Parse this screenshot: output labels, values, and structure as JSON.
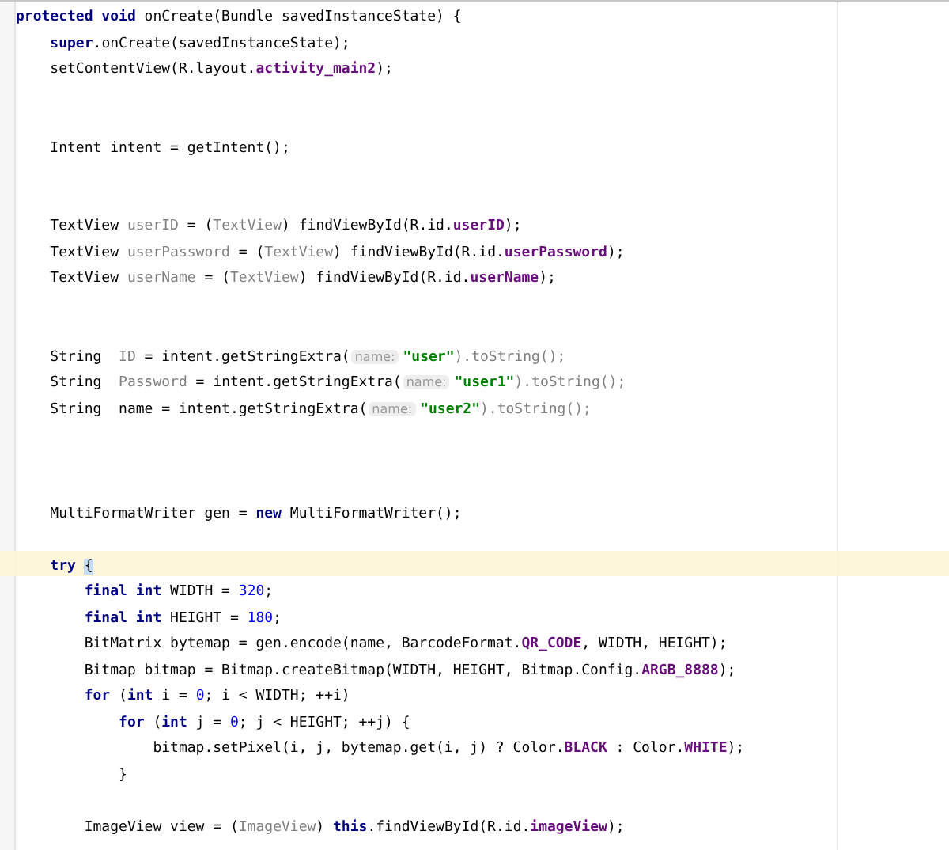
{
  "editor": {
    "lines": [
      {
        "current": false,
        "tokens": [
          {
            "kind": "k",
            "text": "protected void "
          },
          {
            "kind": "p",
            "text": "onCreate(Bundle savedInstanceState) {"
          }
        ]
      },
      {
        "current": false,
        "tokens": [
          {
            "kind": "k",
            "text": "    super"
          },
          {
            "kind": "p",
            "text": ".onCreate(savedInstanceState);"
          }
        ]
      },
      {
        "current": false,
        "tokens": [
          {
            "kind": "p",
            "text": "    setContentView(R.layout."
          },
          {
            "kind": "f",
            "text": "activity_main2"
          },
          {
            "kind": "p",
            "text": ");"
          }
        ]
      },
      {
        "current": false
      },
      {
        "current": false
      },
      {
        "current": false,
        "tokens": [
          {
            "kind": "p",
            "text": "    Intent intent = getIntent();"
          }
        ]
      },
      {
        "current": false
      },
      {
        "current": false
      },
      {
        "current": false,
        "tokens": [
          {
            "kind": "p",
            "text": "    TextView "
          },
          {
            "kind": "g",
            "text": "userID"
          },
          {
            "kind": "p",
            "text": " = ("
          },
          {
            "kind": "g",
            "text": "TextView"
          },
          {
            "kind": "p",
            "text": ") findViewById(R.id."
          },
          {
            "kind": "f",
            "text": "userID"
          },
          {
            "kind": "p",
            "text": ");"
          }
        ]
      },
      {
        "current": false,
        "tokens": [
          {
            "kind": "p",
            "text": "    TextView "
          },
          {
            "kind": "g",
            "text": "userPassword"
          },
          {
            "kind": "p",
            "text": " = ("
          },
          {
            "kind": "g",
            "text": "TextView"
          },
          {
            "kind": "p",
            "text": ") findViewById(R.id."
          },
          {
            "kind": "f",
            "text": "userPassword"
          },
          {
            "kind": "p",
            "text": ");"
          }
        ]
      },
      {
        "current": false,
        "tokens": [
          {
            "kind": "p",
            "text": "    TextView "
          },
          {
            "kind": "g",
            "text": "userName"
          },
          {
            "kind": "p",
            "text": " = ("
          },
          {
            "kind": "g",
            "text": "TextView"
          },
          {
            "kind": "p",
            "text": ") findViewById(R.id."
          },
          {
            "kind": "f",
            "text": "userName"
          },
          {
            "kind": "p",
            "text": ");"
          }
        ]
      },
      {
        "current": false
      },
      {
        "current": false
      },
      {
        "current": false,
        "tokens": [
          {
            "kind": "p",
            "text": "    String  "
          },
          {
            "kind": "g",
            "text": "ID"
          },
          {
            "kind": "p",
            "text": " = intent.getStringExtra("
          },
          {
            "kind": "h",
            "text": "name:"
          },
          {
            "kind": "s",
            "text": "\"user\""
          },
          {
            "kind": "g",
            "text": ").toString();"
          }
        ]
      },
      {
        "current": false,
        "tokens": [
          {
            "kind": "p",
            "text": "    String  "
          },
          {
            "kind": "g",
            "text": "Password"
          },
          {
            "kind": "p",
            "text": " = intent.getStringExtra("
          },
          {
            "kind": "h",
            "text": "name:"
          },
          {
            "kind": "s",
            "text": "\"user1\""
          },
          {
            "kind": "g",
            "text": ").toString();"
          }
        ]
      },
      {
        "current": false,
        "tokens": [
          {
            "kind": "p",
            "text": "    String  name = intent.getStringExtra("
          },
          {
            "kind": "h",
            "text": "name:"
          },
          {
            "kind": "s",
            "text": "\"user2\""
          },
          {
            "kind": "g",
            "text": ").toString();"
          }
        ]
      },
      {
        "current": false
      },
      {
        "current": false
      },
      {
        "current": false
      },
      {
        "current": false,
        "tokens": [
          {
            "kind": "p",
            "text": "    MultiFormatWriter gen = "
          },
          {
            "kind": "k",
            "text": "new"
          },
          {
            "kind": "p",
            "text": " MultiFormatWriter();"
          }
        ]
      },
      {
        "current": false
      },
      {
        "current": true,
        "tokens": [
          {
            "kind": "k",
            "text": "    try"
          },
          {
            "kind": "m",
            "text": " {"
          }
        ]
      },
      {
        "current": false,
        "tokens": [
          {
            "kind": "k",
            "text": "        final int"
          },
          {
            "kind": "p",
            "text": " WIDTH = "
          },
          {
            "kind": "n",
            "text": "320"
          },
          {
            "kind": "p",
            "text": ";"
          }
        ]
      },
      {
        "current": false,
        "tokens": [
          {
            "kind": "k",
            "text": "        final int"
          },
          {
            "kind": "p",
            "text": " HEIGHT = "
          },
          {
            "kind": "n",
            "text": "180"
          },
          {
            "kind": "p",
            "text": ";"
          }
        ]
      },
      {
        "current": false,
        "tokens": [
          {
            "kind": "p",
            "text": "        BitMatrix bytemap = gen.encode(name, BarcodeFormat."
          },
          {
            "kind": "f",
            "text": "QR_CODE"
          },
          {
            "kind": "p",
            "text": ", WIDTH, HEIGHT);"
          }
        ]
      },
      {
        "current": false,
        "tokens": [
          {
            "kind": "p",
            "text": "        Bitmap bitmap = Bitmap.createBitmap(WIDTH, HEIGHT, Bitmap.Config."
          },
          {
            "kind": "f",
            "text": "ARGB_8888"
          },
          {
            "kind": "p",
            "text": ");"
          }
        ]
      },
      {
        "current": false,
        "tokens": [
          {
            "kind": "k",
            "text": "        for"
          },
          {
            "kind": "p",
            "text": " ("
          },
          {
            "kind": "k",
            "text": "int"
          },
          {
            "kind": "p",
            "text": " i = "
          },
          {
            "kind": "n",
            "text": "0"
          },
          {
            "kind": "p",
            "text": "; i < WIDTH; ++i)"
          }
        ]
      },
      {
        "current": false,
        "tokens": [
          {
            "kind": "k",
            "text": "            for"
          },
          {
            "kind": "p",
            "text": " ("
          },
          {
            "kind": "k",
            "text": "int"
          },
          {
            "kind": "p",
            "text": " j = "
          },
          {
            "kind": "n",
            "text": "0"
          },
          {
            "kind": "p",
            "text": "; j < HEIGHT; ++j) {"
          }
        ]
      },
      {
        "current": false,
        "tokens": [
          {
            "kind": "p",
            "text": "                bitmap.setPixel(i, j, bytemap.get(i, j) ? Color."
          },
          {
            "kind": "f",
            "text": "BLACK"
          },
          {
            "kind": "p",
            "text": " : Color."
          },
          {
            "kind": "f",
            "text": "WHITE"
          },
          {
            "kind": "p",
            "text": ");"
          }
        ]
      },
      {
        "current": false,
        "tokens": [
          {
            "kind": "p",
            "text": "            }"
          }
        ]
      },
      {
        "current": false
      },
      {
        "current": false,
        "tokens": [
          {
            "kind": "p",
            "text": "        ImageView view = ("
          },
          {
            "kind": "g",
            "text": "ImageView"
          },
          {
            "kind": "p",
            "text": ") "
          },
          {
            "kind": "k",
            "text": "this"
          },
          {
            "kind": "p",
            "text": ".findViewById(R.id."
          },
          {
            "kind": "f",
            "text": "imageView"
          },
          {
            "kind": "p",
            "text": ");"
          }
        ]
      }
    ]
  }
}
